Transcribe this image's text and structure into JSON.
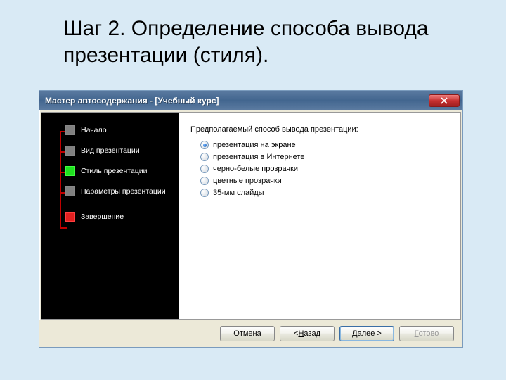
{
  "slide": {
    "title": "Шаг 2. Определение способа вывода презентации (стиля)."
  },
  "dialog": {
    "title": "Мастер автосодержания - [Учебный курс]",
    "nav": {
      "items": [
        {
          "label": "Начало",
          "color": "gray"
        },
        {
          "label": "Вид презентации",
          "color": "gray"
        },
        {
          "label": "Стиль презентации",
          "color": "green"
        },
        {
          "label": "Параметры презентации",
          "color": "gray"
        },
        {
          "label": "Завершение",
          "color": "red"
        }
      ]
    },
    "content": {
      "prompt": "Предполагаемый способ вывода презентации:",
      "options": [
        {
          "label_pre": "презентация на ",
          "label_u": "э",
          "label_post": "кране",
          "checked": true
        },
        {
          "label_pre": "презентация в ",
          "label_u": "И",
          "label_post": "нтернете",
          "checked": false
        },
        {
          "label_pre": "",
          "label_u": "ч",
          "label_post": "ерно-белые прозрачки",
          "checked": false
        },
        {
          "label_pre": "",
          "label_u": "ц",
          "label_post": "ветные прозрачки",
          "checked": false
        },
        {
          "label_pre": "",
          "label_u": "3",
          "label_post": "5-мм слайды",
          "checked": false
        }
      ]
    },
    "buttons": {
      "cancel": "Отмена",
      "back_pre": "< ",
      "back_u": "Н",
      "back_post": "азад",
      "next_u": "Д",
      "next_post": "алее >",
      "finish_u": "Г",
      "finish_post": "отово"
    }
  }
}
